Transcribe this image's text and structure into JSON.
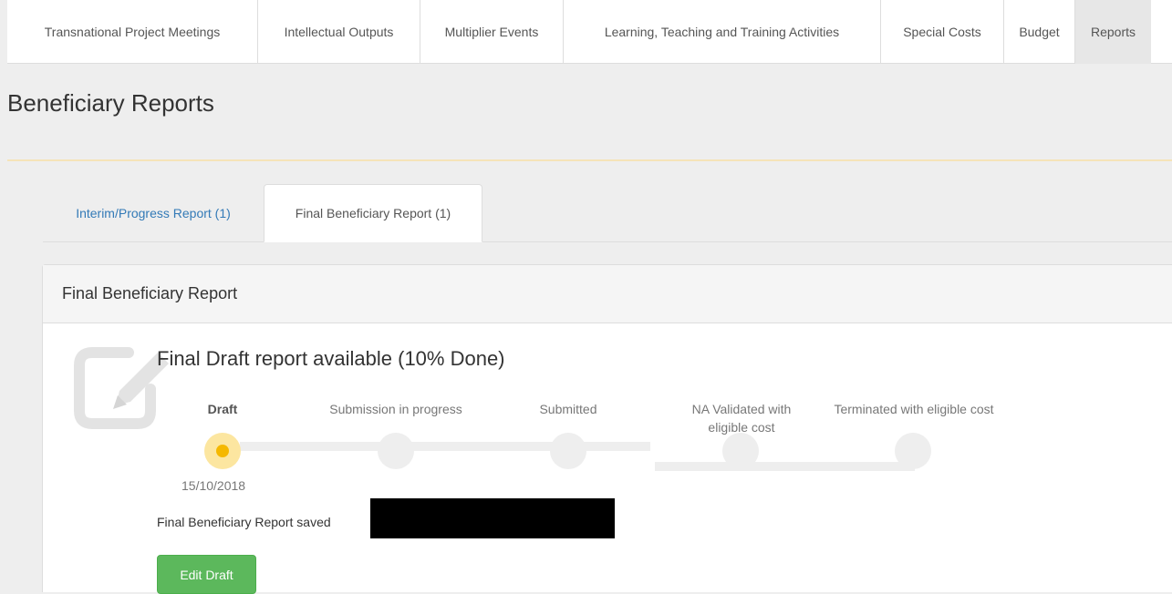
{
  "topnav": {
    "items": [
      {
        "label": "Transnational Project Meetings",
        "active": false
      },
      {
        "label": "Intellectual Outputs",
        "active": false
      },
      {
        "label": "Multiplier Events",
        "active": false
      },
      {
        "label": "Learning, Teaching and Training Activities",
        "active": false
      },
      {
        "label": "Special Costs",
        "active": false
      },
      {
        "label": "Budget",
        "active": false
      },
      {
        "label": "Reports",
        "active": true
      }
    ]
  },
  "page": {
    "title": "Beneficiary Reports"
  },
  "tabs": {
    "interim": "Interim/Progress Report (1)",
    "final": "Final Beneficiary Report (1)",
    "active": "final"
  },
  "panel": {
    "heading": "Final Beneficiary Report",
    "status_title": "Final Draft report available (10% Done)",
    "progress_percent": 10,
    "steps": [
      {
        "label": "Draft",
        "current": true
      },
      {
        "label": "Submission in progress",
        "current": false
      },
      {
        "label": "Submitted",
        "current": false
      },
      {
        "label": "NA Validated with eligible cost",
        "current": false
      },
      {
        "label": "Terminated with eligible cost",
        "current": false
      }
    ],
    "current_step_date": "15/10/2018",
    "saved_text": "Final Beneficiary Report saved",
    "edit_button_label": "Edit Draft",
    "background_icon": "edit-pencil-icon"
  },
  "colors": {
    "accent_green": "#5cb85c",
    "link_blue": "#337ab7",
    "current_step": "#f5b800"
  }
}
